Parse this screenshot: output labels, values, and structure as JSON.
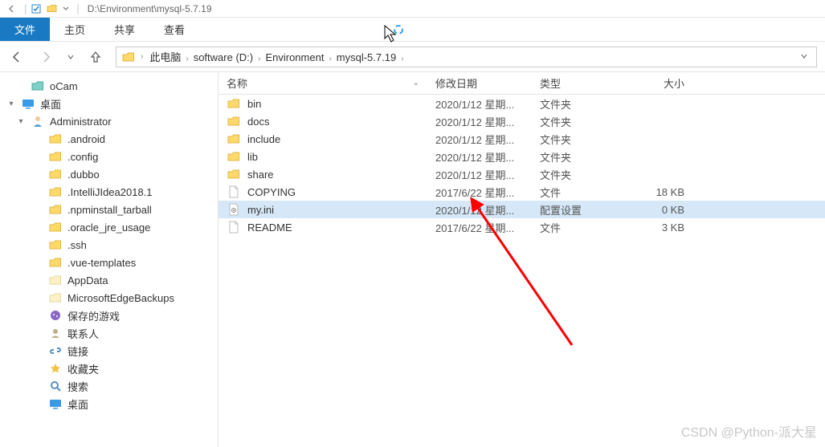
{
  "titlebar": {
    "path": "D:\\Environment\\mysql-5.7.19"
  },
  "ribbon": {
    "tabs": [
      {
        "label": "文件",
        "active": true
      },
      {
        "label": "主页",
        "active": false
      },
      {
        "label": "共享",
        "active": false
      },
      {
        "label": "查看",
        "active": false
      }
    ]
  },
  "breadcrumb": {
    "items": [
      "此电脑",
      "software (D:)",
      "Environment",
      "mysql-5.7.19"
    ]
  },
  "sidebar": {
    "items": [
      {
        "depth": 1,
        "icon": "folder-teal",
        "label": "oCam",
        "twisty": ""
      },
      {
        "depth": 0,
        "icon": "desktop",
        "label": "桌面",
        "twisty": "▾"
      },
      {
        "depth": 1,
        "icon": "user",
        "label": "Administrator",
        "twisty": "▾"
      },
      {
        "depth": 2,
        "icon": "folder",
        "label": ".android",
        "twisty": ""
      },
      {
        "depth": 2,
        "icon": "folder",
        "label": ".config",
        "twisty": ""
      },
      {
        "depth": 2,
        "icon": "folder",
        "label": ".dubbo",
        "twisty": ""
      },
      {
        "depth": 2,
        "icon": "folder",
        "label": ".IntelliJIdea2018.1",
        "twisty": ""
      },
      {
        "depth": 2,
        "icon": "folder",
        "label": ".npminstall_tarball",
        "twisty": ""
      },
      {
        "depth": 2,
        "icon": "folder",
        "label": ".oracle_jre_usage",
        "twisty": ""
      },
      {
        "depth": 2,
        "icon": "folder",
        "label": ".ssh",
        "twisty": ""
      },
      {
        "depth": 2,
        "icon": "folder",
        "label": ".vue-templates",
        "twisty": ""
      },
      {
        "depth": 2,
        "icon": "folder-pale",
        "label": "AppData",
        "twisty": ""
      },
      {
        "depth": 2,
        "icon": "folder-pale",
        "label": "MicrosoftEdgeBackups",
        "twisty": ""
      },
      {
        "depth": 2,
        "icon": "games",
        "label": "保存的游戏",
        "twisty": ""
      },
      {
        "depth": 2,
        "icon": "contacts",
        "label": "联系人",
        "twisty": ""
      },
      {
        "depth": 2,
        "icon": "links",
        "label": "链接",
        "twisty": ""
      },
      {
        "depth": 2,
        "icon": "favorites",
        "label": "收藏夹",
        "twisty": ""
      },
      {
        "depth": 2,
        "icon": "search",
        "label": "搜索",
        "twisty": ""
      },
      {
        "depth": 2,
        "icon": "desktop",
        "label": "桌面",
        "twisty": ""
      }
    ]
  },
  "columns": {
    "name": "名称",
    "date": "修改日期",
    "type": "类型",
    "size": "大小"
  },
  "files": [
    {
      "icon": "folder",
      "name": "bin",
      "date": "2020/1/12 星期...",
      "type": "文件夹",
      "size": "",
      "selected": false
    },
    {
      "icon": "folder",
      "name": "docs",
      "date": "2020/1/12 星期...",
      "type": "文件夹",
      "size": "",
      "selected": false
    },
    {
      "icon": "folder",
      "name": "include",
      "date": "2020/1/12 星期...",
      "type": "文件夹",
      "size": "",
      "selected": false
    },
    {
      "icon": "folder",
      "name": "lib",
      "date": "2020/1/12 星期...",
      "type": "文件夹",
      "size": "",
      "selected": false
    },
    {
      "icon": "folder",
      "name": "share",
      "date": "2020/1/12 星期...",
      "type": "文件夹",
      "size": "",
      "selected": false
    },
    {
      "icon": "file",
      "name": "COPYING",
      "date": "2017/6/22 星期...",
      "type": "文件",
      "size": "18 KB",
      "selected": false
    },
    {
      "icon": "ini",
      "name": "my.ini",
      "date": "2020/1/12 星期...",
      "type": "配置设置",
      "size": "0 KB",
      "selected": true
    },
    {
      "icon": "file",
      "name": "README",
      "date": "2017/6/22 星期...",
      "type": "文件",
      "size": "3 KB",
      "selected": false
    }
  ],
  "watermark": "CSDN @Python-派大星"
}
